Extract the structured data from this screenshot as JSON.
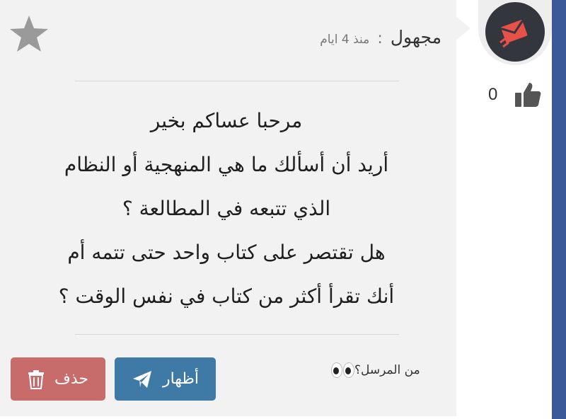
{
  "post": {
    "author": "مجهول",
    "separator": ":",
    "time_ago": "منذ 4 ايام",
    "message_lines": [
      "مرحبا عساكم بخير",
      "أريد أن أسألك ما هي المنهجية أو النظام",
      "الذي تتبعه في المطالعة ؟",
      "هل تقتصر على كتاب واحد حتى تتمه أم",
      "أنك تقرأ أكثر من كتاب في نفس الوقت ؟"
    ],
    "likes": "0",
    "sender_question": "من المرسل؟",
    "sender_question_icon": "eyes-emoji-icon"
  },
  "actions": {
    "show_label": "أظهار",
    "show_icon": "paper-plane-icon",
    "delete_label": "حذف",
    "delete_icon": "trash-icon"
  },
  "colors": {
    "brand_strip": "#3b5998",
    "avatar_bg": "#34363d",
    "avatar_accent": "#e8504a",
    "show_button": "#3f7aa6",
    "delete_button": "#c76b6b",
    "card_bg": "#f2f2f2",
    "star": "#9a9a9a"
  }
}
